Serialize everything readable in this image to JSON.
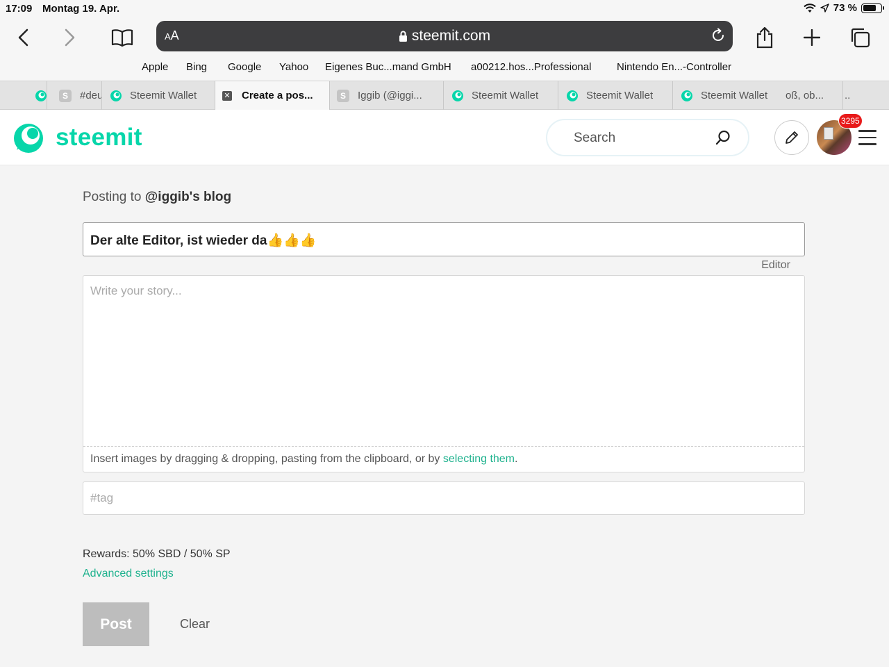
{
  "status": {
    "time": "17:09",
    "date": "Montag 19. Apr.",
    "battery": "73 %",
    "battery_level": 0.73
  },
  "browser": {
    "aa_label": "AA",
    "url_host": "steemit.com",
    "favorites": [
      "Apple",
      "Bing",
      "Google",
      "Yahoo",
      "Eigenes Buc...mand GmbH",
      "a00212.hos...Professional",
      "Nintendo En...-Controller"
    ],
    "tabs": [
      {
        "label": "",
        "icon": "steemit-logo-icon"
      },
      {
        "label": "#deu",
        "icon": "s-favicon-icon"
      },
      {
        "label": "Steemit Wallet",
        "icon": "steemit-logo-icon"
      },
      {
        "label": "Create a pos...",
        "icon": "close-icon",
        "active": true
      },
      {
        "label": "Iggib (@iggi...",
        "icon": "s-favicon-icon"
      },
      {
        "label": "Steemit Wallet",
        "icon": "steemit-logo-icon"
      },
      {
        "label": "Steemit Wallet",
        "icon": "steemit-logo-icon"
      },
      {
        "label": "Steemit Wallet",
        "icon": "steemit-logo-icon"
      },
      {
        "label": "oß, ob...",
        "icon": ""
      },
      {
        "label": "..",
        "icon": ""
      }
    ]
  },
  "site": {
    "brand": "steemit",
    "brand_color": "#07d6aa",
    "search_placeholder": "Search",
    "notification_count": "3295"
  },
  "form": {
    "posting_prefix": "Posting to ",
    "posting_account": "@iggib's blog",
    "title_value": "Der alte Editor, ist wieder da👍👍👍",
    "editor_toggle": "Editor",
    "body_placeholder": "Write your story...",
    "drop_hint": "Insert images by dragging & dropping, pasting from the clipboard, or by ",
    "drop_link": "selecting them",
    "drop_end": ".",
    "tag_placeholder": "#tag",
    "rewards": "Rewards: 50% SBD / 50% SP",
    "advanced_settings": "Advanced settings",
    "post_label": "Post",
    "clear_label": "Clear",
    "link_color": "#1fb28e"
  }
}
